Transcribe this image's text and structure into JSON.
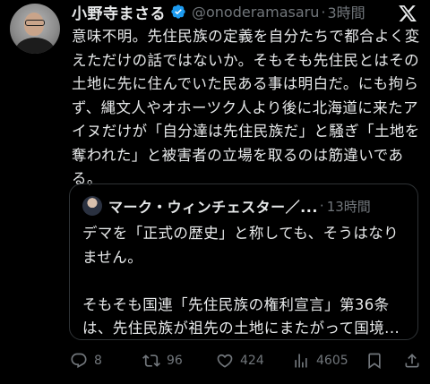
{
  "tweet": {
    "author_name": "小野寺まさる",
    "handle": "@onoderamasaru",
    "separator": "·",
    "time": "3時間",
    "text": "意味不明。先住民族の定義を自分たちで都合よく変えただけの話ではないか。そもそも先住民とはその土地に先に住んでいた民ある事は明白だ。にも拘らず、縄文人やオホーツク人より後に北海道に来たアイヌだけが「自分達は先住民族だ」と騒ぎ「土地を奪われた」と被害者の立場を取るのは筋違いである。"
  },
  "quote": {
    "author_name": "マーク・ウィンチェスター／...",
    "separator": "·",
    "time": "13時間",
    "text": "デマを「正式の歴史」と称しても、そうはなりません。\n\nそもそも国連「先住民族の権利宣言」第36条は、先住民族が祖先の土地にまたがって国境..."
  },
  "actions": {
    "reply_count": "8",
    "retweet_count": "96",
    "like_count": "424",
    "view_count": "4605"
  },
  "icons": {
    "verified": "verified-badge-icon",
    "logo": "x-logo-icon",
    "reply": "reply-icon",
    "retweet": "retweet-icon",
    "like": "heart-icon",
    "views": "views-chart-icon",
    "bookmark": "bookmark-icon",
    "share": "share-icon"
  },
  "colors": {
    "background": "#000000",
    "text": "#e7e9ea",
    "muted": "#71767b",
    "verified": "#1d9bf0",
    "border": "#2f3336"
  }
}
